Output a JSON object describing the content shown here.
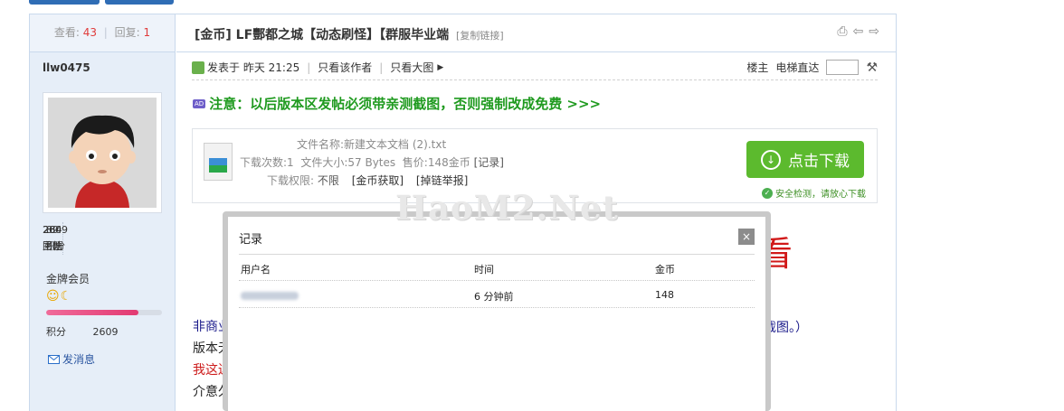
{
  "thread": {
    "views_label": "查看:",
    "views": "43",
    "replies_label": "回复:",
    "replies": "1",
    "title": "[金币] LF酆都之城【动态刷怪】【群服毕业端",
    "copy_link": "[复制链接]"
  },
  "author": {
    "username": "llw0475",
    "stats": [
      {
        "value": "284",
        "label": "主题"
      },
      {
        "value": "89",
        "label": "回帖"
      },
      {
        "value": "2609",
        "label": "积分"
      }
    ],
    "rank": "金牌会员",
    "rank_icons": "☺☾",
    "progress_fraction": 0.8,
    "points_label": "积分",
    "points_value": "2609",
    "send_message": "发消息"
  },
  "post": {
    "posted": "发表于 昨天 21:25",
    "only_author": "只看该作者",
    "only_big_image": "只看大图",
    "floor": "楼主",
    "elevator": "电梯直达",
    "notice": "注意：以后版本区发帖必须带亲测截图，否则强制改成免费 >>>",
    "ad_badge": "AD"
  },
  "attachment": {
    "filename_label": "文件名称:",
    "filename": "新建文本文档 (2).txt",
    "downloads_label": "下载次数:",
    "downloads": "1",
    "size_label": "文件大小:",
    "size": "57 Bytes",
    "price_label": "售价:",
    "price": "148金币",
    "record_link": "[记录]",
    "permission_label": "下载权限:",
    "permission": "不限",
    "get_coins_link": "[金币获取]",
    "report_link": "[掉链举报]",
    "download_button": "点击下载",
    "safe_text": "安全检测，请放心下载"
  },
  "watermark": "HaoM2.Net",
  "body": {
    "big_red_text": "看",
    "line1": "非商业",
    "line1_tail": "有截图。）",
    "line2": "版本无",
    "line3": "我这边",
    "line4": "介意久"
  },
  "modal": {
    "title": "记录",
    "close": "×",
    "columns": [
      "用户名",
      "时间",
      "金币"
    ],
    "rows": [
      {
        "time": "6 分钟前",
        "coins": "148"
      }
    ]
  },
  "colors": {
    "accent_blue": "#2f6db5",
    "notice_green": "#1f9a1f",
    "download_green": "#5cba2e",
    "red_text": "#d11919"
  }
}
